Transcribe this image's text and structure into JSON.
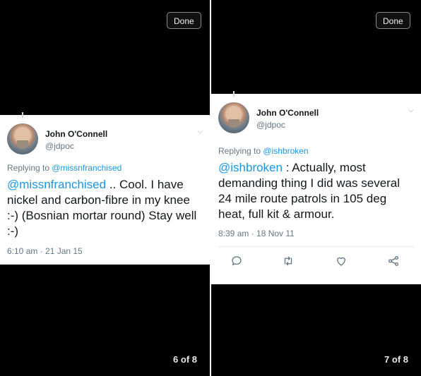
{
  "panels": [
    {
      "done_label": "Done",
      "counter": "6 of 8",
      "tweet": {
        "author_name": "John O'Connell",
        "author_handle": "@jdpoc",
        "replying_prefix": "Replying to ",
        "replying_to": "@missnfranchised",
        "mention": "@missnfranchised",
        "body": " .. Cool. I have nickel and carbon-fibre in my knee :-) (Bosnian mortar round) Stay well :-)",
        "timestamp": "6:10 am · 21 Jan 15"
      }
    },
    {
      "done_label": "Done",
      "counter": "7 of 8",
      "tweet": {
        "author_name": "John O'Connell",
        "author_handle": "@jdpoc",
        "replying_prefix": "Replying to ",
        "replying_to": "@ishbroken",
        "mention": "@ishbroken",
        "body": " : Actually, most demanding thing I did was several 24 mile route patrols in 105 deg heat, full kit & armour.",
        "timestamp": "8:39 am · 18 Nov 11",
        "actions": [
          "reply-icon",
          "retweet-icon",
          "like-icon",
          "share-icon"
        ]
      }
    }
  ]
}
